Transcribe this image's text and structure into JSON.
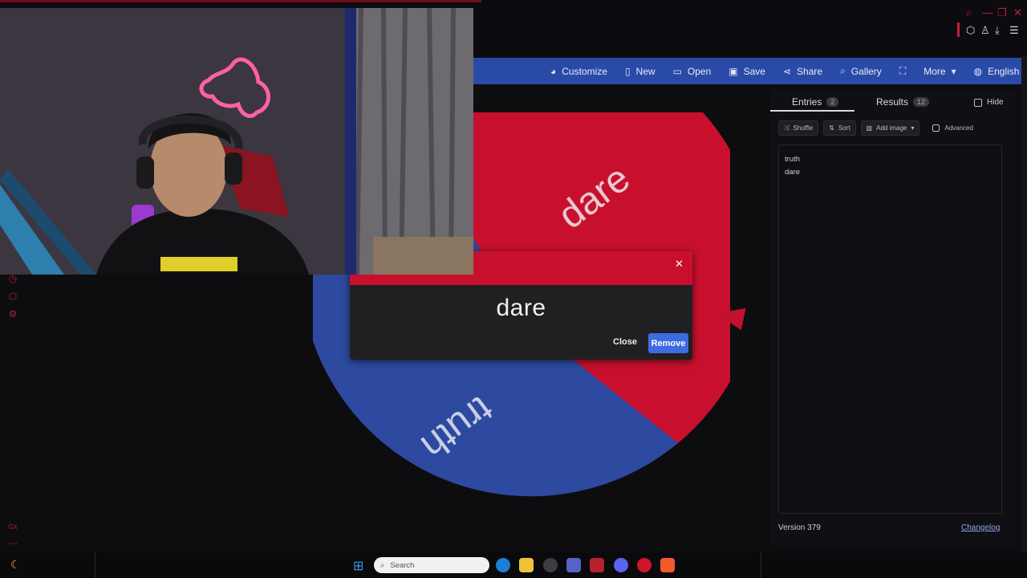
{
  "app": {
    "navbar": {
      "items": [
        {
          "label": "Customize",
          "icon": "palette-icon"
        },
        {
          "label": "New",
          "icon": "file-icon"
        },
        {
          "label": "Open",
          "icon": "folder-open-icon"
        },
        {
          "label": "Save",
          "icon": "save-icon"
        },
        {
          "label": "Share",
          "icon": "share-icon"
        },
        {
          "label": "Gallery",
          "icon": "search-icon"
        },
        {
          "label": "",
          "icon": "fullscreen-icon"
        },
        {
          "label": "More",
          "icon": "chevron-down-icon"
        },
        {
          "label": "English",
          "icon": "globe-icon"
        }
      ]
    },
    "wheel": {
      "slices": [
        {
          "label": "dare",
          "color": "#c8102e"
        },
        {
          "label": "truth",
          "color": "#2d4aa0"
        }
      ],
      "pointer_color": "#c2122b"
    },
    "panel": {
      "tabs": [
        {
          "label": "Entries",
          "count": "2"
        },
        {
          "label": "Results",
          "count": "12"
        }
      ],
      "hide_label": "Hide",
      "toolbar": {
        "shuffle": "Shuffle",
        "sort": "Sort",
        "add_image": "Add image",
        "advanced": "Advanced"
      },
      "entries": [
        "truth",
        "dare"
      ],
      "version": "Version 379",
      "changelog": "Changelog"
    },
    "dialog": {
      "result": "dare",
      "close_label": "Close",
      "remove_label": "Remove",
      "header_color": "#c8102e",
      "remove_color": "#3d6ce0"
    }
  },
  "taskbar": {
    "search_placeholder": "Search"
  },
  "colors": {
    "navbar": "#2a4aa8",
    "accent_red": "#c4203a"
  }
}
